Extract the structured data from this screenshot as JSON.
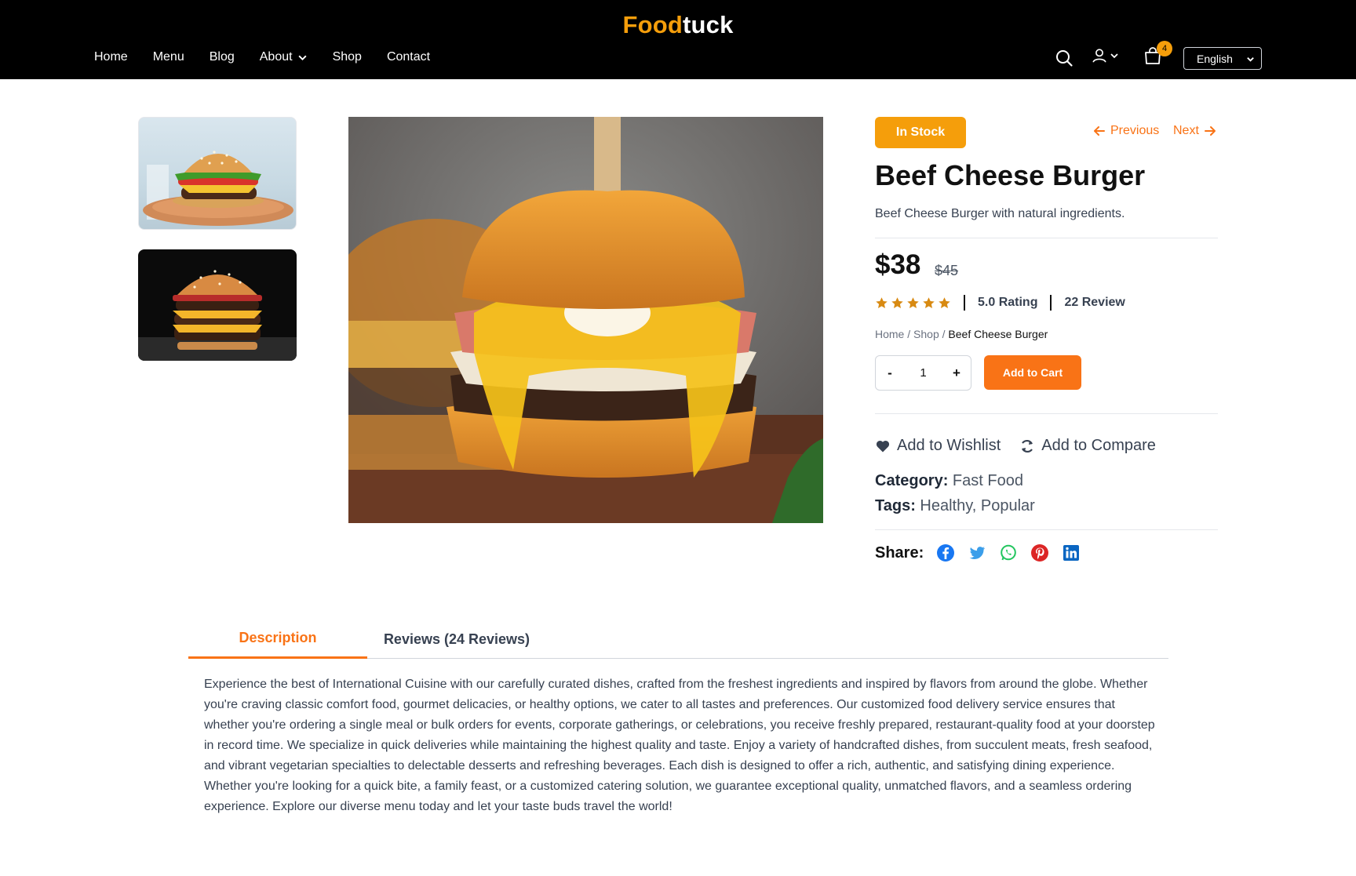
{
  "header": {
    "logo_part1": "Food",
    "logo_part2": "tuck",
    "nav": [
      "Home",
      "Menu",
      "Blog",
      "About",
      "Shop",
      "Contact"
    ],
    "cart_count": "4",
    "language": "English"
  },
  "product": {
    "stock_label": "In Stock",
    "prev_label": "Previous",
    "next_label": "Next",
    "title": "Beef Cheese Burger",
    "subtitle": "Beef Cheese Burger with natural ingredients.",
    "price": "$38",
    "old_price": "$45",
    "rating_stars": 5,
    "rating_text": "5.0 Rating",
    "review_text": "22 Review",
    "breadcrumb_home": "Home",
    "breadcrumb_shop": "Shop",
    "breadcrumb_current": "Beef Cheese Burger",
    "breadcrumb_sep": " / ",
    "qty_minus": "-",
    "qty_value": "1",
    "qty_plus": "+",
    "add_to_cart": "Add to Cart",
    "wishlist": "Add to Wishlist",
    "compare": "Add to Compare",
    "category_label": "Category:",
    "category_value": "Fast Food",
    "tags_label": "Tags:",
    "tags_value": "Healthy, Popular",
    "share_label": "Share:"
  },
  "tabs": {
    "description": "Description",
    "reviews": "Reviews (24 Reviews)"
  },
  "description_text": "Experience the best of International Cuisine with our carefully curated dishes, crafted from the freshest ingredients and inspired by flavors from around the globe. Whether you're craving classic comfort food, gourmet delicacies, or healthy options, we cater to all tastes and preferences. Our customized food delivery service ensures that whether you're ordering a single meal or bulk orders for events, corporate gatherings, or celebrations, you receive freshly prepared, restaurant-quality food at your doorstep in record time. We specialize in quick deliveries while maintaining the highest quality and taste. Enjoy a variety of handcrafted dishes, from succulent meats, fresh seafood, and vibrant vegetarian specialties to delectable desserts and refreshing beverages. Each dish is designed to offer a rich, authentic, and satisfying dining experience. Whether you're looking for a quick bite, a family feast, or a customized catering solution, we guarantee exceptional quality, unmatched flavors, and a seamless ordering experience. Explore our diverse menu today and let your taste buds travel the world!",
  "colors": {
    "accent": "#f97316",
    "stock": "#f59e0b",
    "header_bg": "#000000"
  }
}
